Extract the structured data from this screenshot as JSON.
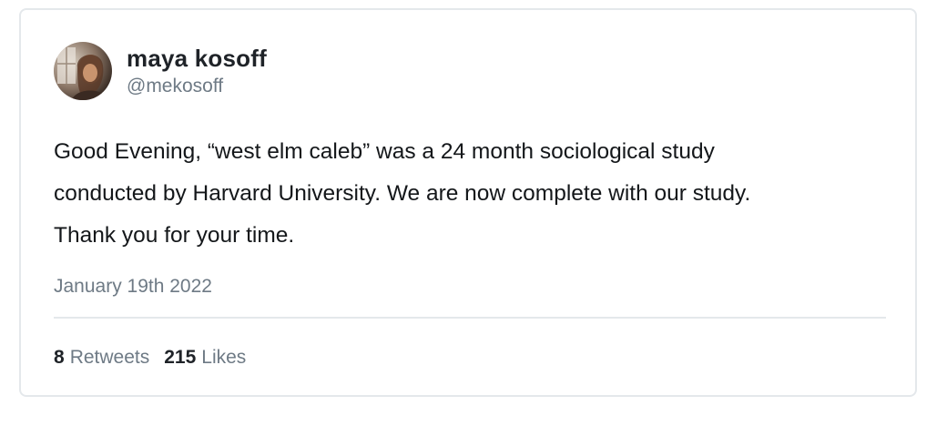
{
  "tweet": {
    "author": {
      "display_name": "maya kosoff",
      "handle": "@mekosoff",
      "avatar_icon": "profile-photo"
    },
    "text_lines": [
      "Good Evening, “west elm caleb” was a 24 month sociological study",
      "conducted by Harvard University. We are now complete with our study.",
      "Thank you for your time."
    ],
    "date": "January 19th 2022",
    "stats": {
      "retweets_count": "8",
      "retweets_label": "Retweets",
      "likes_count": "215",
      "likes_label": "Likes"
    }
  },
  "colors": {
    "text_primary": "#14171a",
    "text_secondary": "#6e7a85",
    "border": "#e4e8eb"
  }
}
